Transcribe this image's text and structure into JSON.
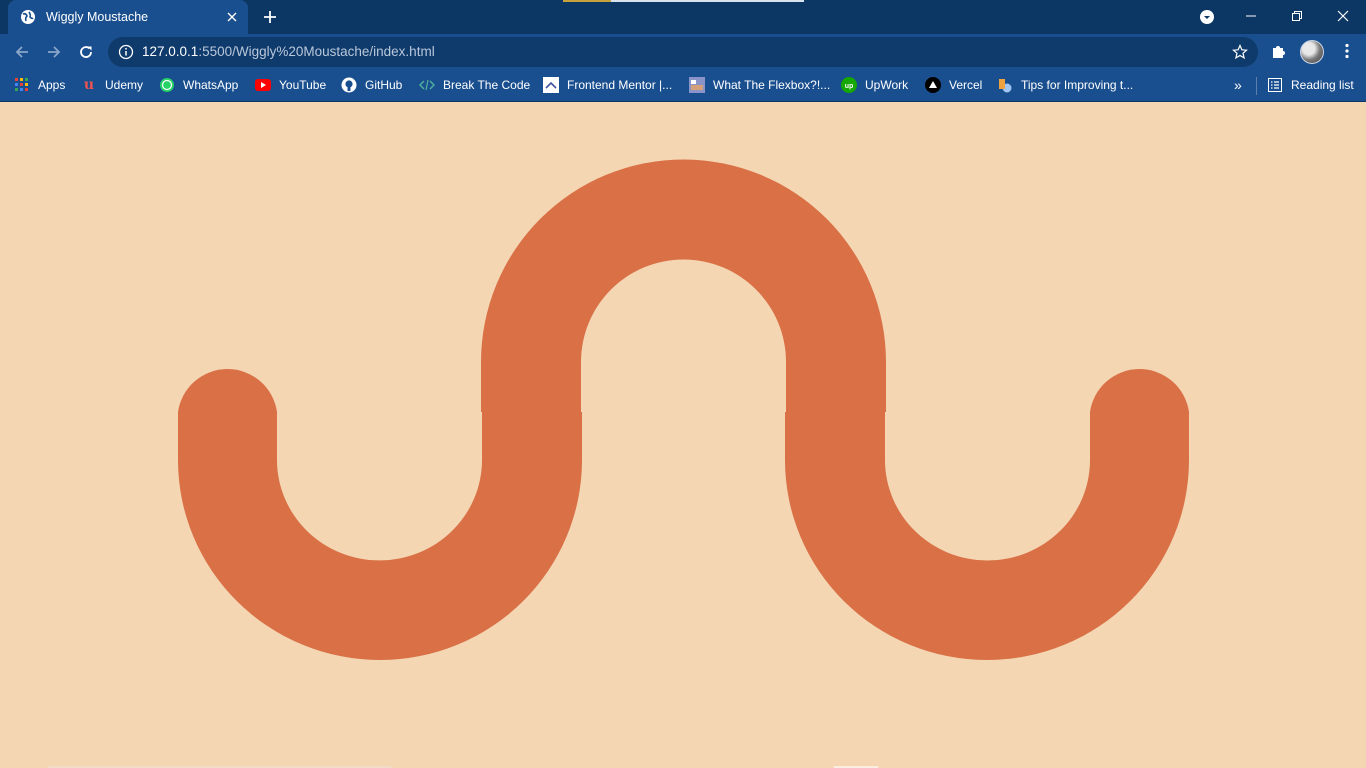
{
  "browser": {
    "tab": {
      "title": "Wiggly Moustache",
      "close_icon": "close-icon"
    },
    "new_tab_icon": "plus-icon",
    "window_controls": [
      "minimize-icon",
      "restore-icon",
      "close-icon"
    ],
    "toolbar": {
      "back_icon": "arrow-left-icon",
      "forward_icon": "arrow-right-icon",
      "reload_icon": "reload-icon",
      "url_host": "127.0.0.1",
      "url_rest": ":5500/Wiggly%20Moustache/index.html"
    },
    "bookmarks": [
      {
        "label": "Apps",
        "icon": "apps-grid-icon"
      },
      {
        "label": "Udemy",
        "icon": "udemy-icon"
      },
      {
        "label": "WhatsApp",
        "icon": "whatsapp-icon"
      },
      {
        "label": "YouTube",
        "icon": "youtube-icon"
      },
      {
        "label": "GitHub",
        "icon": "github-icon"
      },
      {
        "label": "Break The Code",
        "icon": "code-icon"
      },
      {
        "label": "Frontend Mentor |...",
        "icon": "frontend-mentor-icon"
      },
      {
        "label": "What The Flexbox?!...",
        "icon": "flexbox-icon"
      },
      {
        "label": "UpWork",
        "icon": "upwork-icon"
      },
      {
        "label": "Vercel",
        "icon": "vercel-icon"
      },
      {
        "label": "Tips for Improving t...",
        "icon": "tips-icon"
      }
    ],
    "overflow_label": "»",
    "reading_list": {
      "label": "Reading list",
      "icon": "reading-list-icon"
    }
  },
  "page": {
    "background_color": "#f4d6b3",
    "moustache_color": "#d97046"
  },
  "colors": {
    "titlebar": "#0c3764",
    "toolbar": "#1a4f8f",
    "omnibox": "#0f3a6c"
  }
}
